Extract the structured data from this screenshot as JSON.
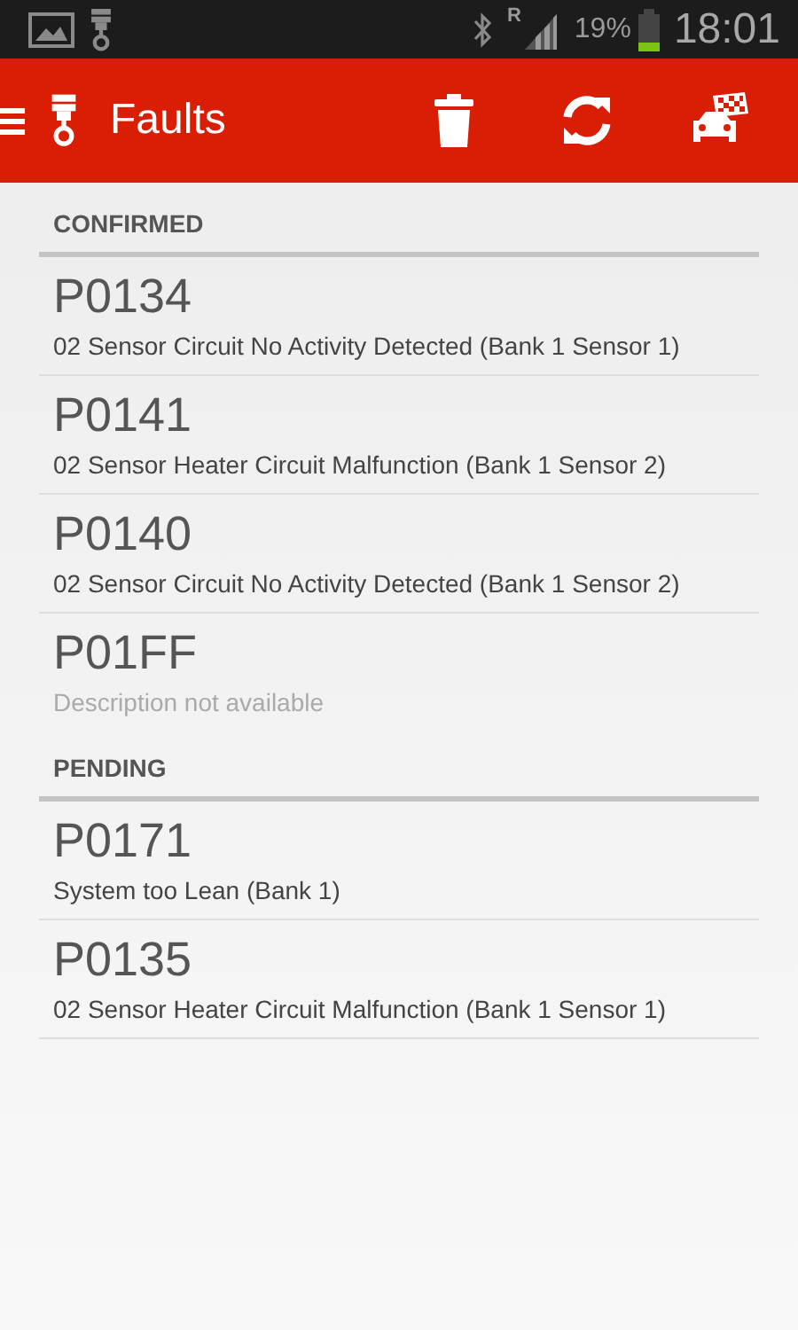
{
  "status_bar": {
    "network": "R",
    "battery": "19%",
    "time": "18:01"
  },
  "app_bar": {
    "title": "Faults"
  },
  "sections": [
    {
      "title": "CONFIRMED",
      "faults": [
        {
          "code": "P0134",
          "description": "02 Sensor Circuit No Activity Detected (Bank 1 Sensor 1)",
          "available": true
        },
        {
          "code": "P0141",
          "description": "02 Sensor Heater Circuit Malfunction (Bank 1 Sensor 2)",
          "available": true
        },
        {
          "code": "P0140",
          "description": "02 Sensor Circuit No Activity Detected (Bank 1 Sensor 2)",
          "available": true
        },
        {
          "code": "P01FF",
          "description": "Description not available",
          "available": false
        }
      ]
    },
    {
      "title": "PENDING",
      "faults": [
        {
          "code": "P0171",
          "description": "System too Lean (Bank 1)",
          "available": true
        },
        {
          "code": "P0135",
          "description": "02 Sensor Heater Circuit Malfunction (Bank 1 Sensor 1)",
          "available": true
        }
      ]
    }
  ]
}
